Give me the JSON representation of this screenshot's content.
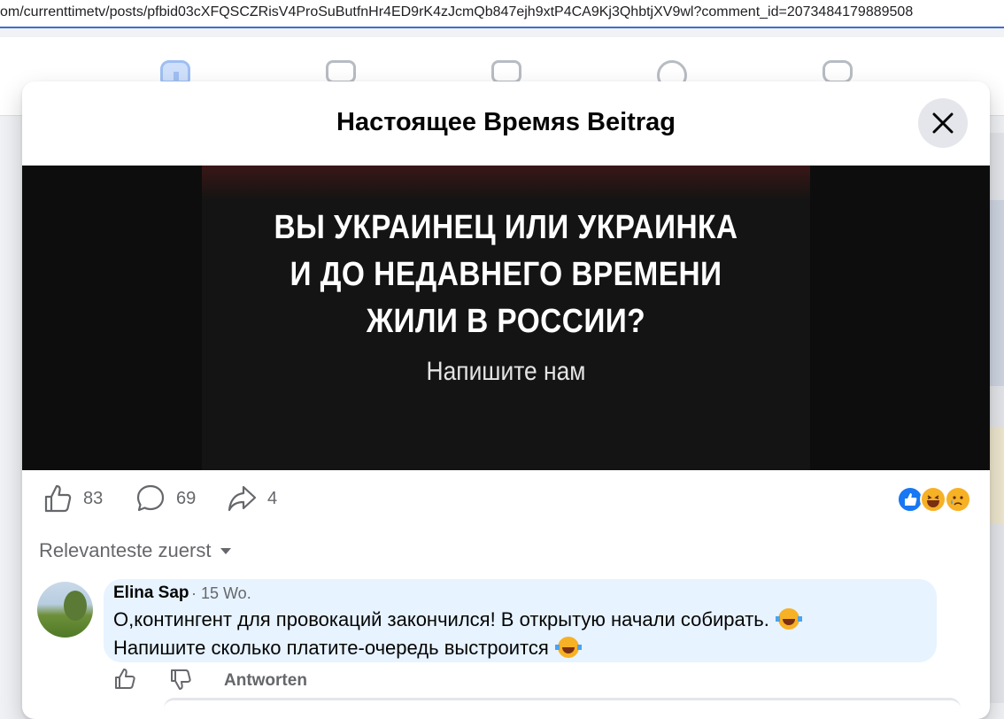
{
  "browser": {
    "url": "om/currenttimetv/posts/pfbid03cXFQSCZRisV4ProSuButfnHr4ED9rK4zJcmQb847ejh9xtP4CA9Kj3QhbtjXV9wl?comment_id=2073484179889508"
  },
  "modal": {
    "title": "Настоящее Времяs Beitrag",
    "close_icon": "close-icon"
  },
  "post": {
    "image_headline": "ВЫ УКРАИНЕЦ ИЛИ УКРАИНКА\nИ ДО НЕДАВНЕГО ВРЕМЕНИ\nЖИЛИ В РОССИИ?",
    "image_cta": "Напишите нам",
    "likes": "83",
    "comments": "69",
    "shares": "4",
    "reactions": [
      "like-reaction-icon",
      "haha-reaction-icon",
      "sad-reaction-icon"
    ]
  },
  "comments": {
    "sort_label": "Relevanteste zuerst",
    "items": [
      {
        "author": "Elina Sap",
        "time": "· 15 Wo.",
        "line1": "О,контингент для провокаций закончился! В открытую начали собирать.",
        "line2": "Напишите сколько платите-очередь выстроится",
        "reply_label": "Antworten"
      }
    ]
  },
  "colors": {
    "accent": "#1877f2",
    "bubble": "#e7f3ff",
    "secondary_text": "#65676b"
  }
}
